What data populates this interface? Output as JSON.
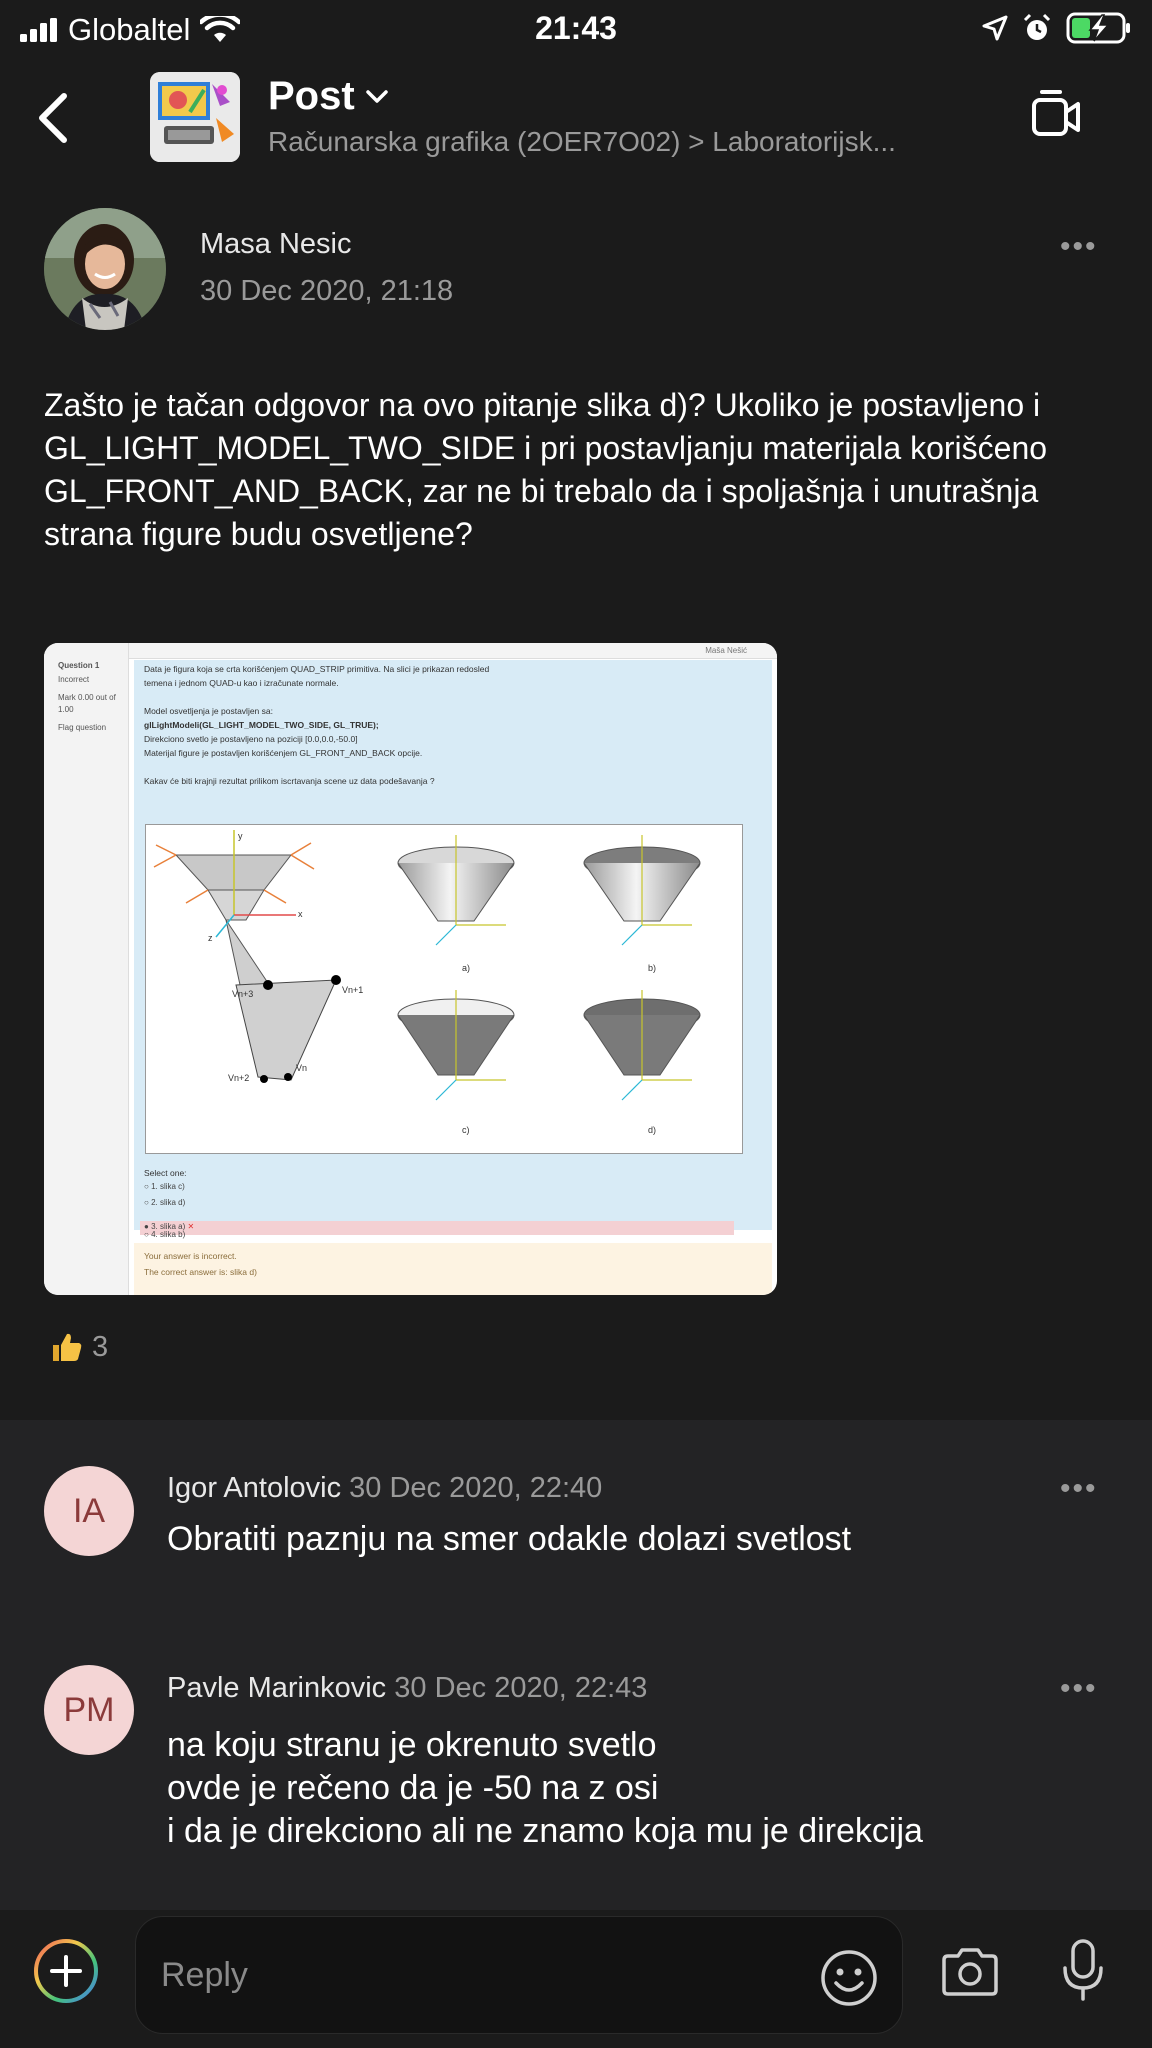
{
  "status_bar": {
    "carrier": "Globaltel",
    "time": "21:43"
  },
  "header": {
    "title": "Post",
    "breadcrumb": "Računarska grafika (2OER7O02) > Laboratorijsk..."
  },
  "post": {
    "author": "Masa Nesic",
    "date": "30 Dec 2020, 21:18",
    "more_icon": "•••",
    "body": "Zašto je tačan odgovor na ovo pitanje slika d)? Ukoliko je postavljeno i GL_LIGHT_MODEL_TWO_SIDE i pri postavljanju materijala korišćeno GL_FRONT_AND_BACK, zar ne bi trebalo da i spoljašnja i unutrašnja strana figure budu osvetljene?",
    "attachment": {
      "sidebar": {
        "question": "Question 1",
        "status": "Incorrect",
        "mark_line1": "Mark 0.00 out of",
        "mark_line2": "1.00",
        "flag": "Flag question"
      },
      "user": "Maša Nešić",
      "lines": [
        "Data je figura koja se crta korišćenjem QUAD_STRIP primitiva. Na slici je prikazan redosled",
        "temena i jednom QUAD-u kao i izračunate normale.",
        "Model osvetljenja je postavljen sa:",
        "glLightModeli(GL_LIGHT_MODEL_TWO_SIDE, GL_TRUE);",
        "Direkciono svetlo je postavljeno na poziciji [0.0,0.0,-50.0]",
        "Materijal figure je postavljen korišćenjem GL_FRONT_AND_BACK opcije.",
        "Kakav će biti krajnji rezultat prilikom iscrtavanja scene uz data podešavanja ?"
      ],
      "figure_labels": {
        "a": "a)",
        "b": "b)",
        "c": "c)",
        "d": "d)",
        "vn": "Vn",
        "vn1": "Vn+1",
        "vn2": "Vn+2",
        "vn3": "Vn+3",
        "x": "x",
        "y": "y",
        "z": "z"
      },
      "select_one": "Select one:",
      "options": [
        "1. slika c)",
        "2. slika d)",
        "3. slika a)",
        "4. slika b)"
      ],
      "feedback": [
        "Your answer is incorrect.",
        "The correct answer is: slika d)"
      ]
    },
    "reaction_count": "3"
  },
  "comments": [
    {
      "initials": "IA",
      "name": "Igor Antolovic",
      "date": "30 Dec 2020, 22:40",
      "text": "Obratiti paznju na smer odakle dolazi svetlost"
    },
    {
      "initials": "PM",
      "name": "Pavle Marinkovic",
      "date": "30 Dec 2020, 22:43",
      "lines": [
        "na koju stranu je okrenuto svetlo",
        "ovde je rečeno da je -50 na z osi",
        "i da je direkciono ali ne znamo koja mu je direkcija"
      ]
    }
  ],
  "composer": {
    "placeholder": "Reply"
  },
  "icons": {
    "signal": "signal-icon",
    "wifi": "wifi-icon",
    "location": "location-icon",
    "alarm": "alarm-icon",
    "battery": "battery-charging-icon",
    "back": "chevron-left-icon",
    "dropdown": "chevron-down-icon",
    "video": "video-call-icon",
    "thumbs_up": "thumbs-up-icon",
    "add": "add-circle-icon",
    "emoji": "emoji-icon",
    "camera": "camera-icon",
    "mic": "microphone-icon"
  },
  "colors": {
    "background": "#1b1b1b",
    "comments_background": "#232325",
    "secondary_text": "#9a9a9a",
    "avatar_bg": "#f4d5d5",
    "avatar_text": "#8b3a3a",
    "battery_green": "#4cd964"
  }
}
